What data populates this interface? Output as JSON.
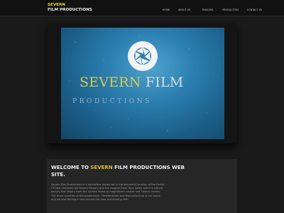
{
  "logo": {
    "line1": "SEVERN",
    "line2": "FILM PRODUCTIONS"
  },
  "nav": {
    "items": [
      {
        "label": "HOME"
      },
      {
        "label": "ABOUT US"
      },
      {
        "label": "TRAILERS"
      },
      {
        "label": "PRODUCTION"
      },
      {
        "label": "CONTACT US"
      }
    ]
  },
  "hero": {
    "brand_word1": "SEVERN",
    "brand_word2": "FILM",
    "brand_sub": "PRODUCTIONS",
    "logo_icon": "camera-aperture-icon"
  },
  "content": {
    "heading_part1": "WELCOME TO ",
    "heading_accent": "SEVERN",
    "heading_part2": " FILM PRODUCTIONS WEB SITE.",
    "body": "Severn Film Productions is a production house set in the wonderful location of the Forest Of Dean between the Severn Estuary and the magical River Wye Valley with it's natural beauty and history from the ancient forest to magnificent castles and historic homes. The three counties of Gloucestershire , Herefordshire and Worcestershire is our home and we love filming in and around the area and sharing with"
  },
  "colors": {
    "accent": "#e2c22a",
    "background": "#1a1a1a",
    "hero_blue": "#2a7eae"
  }
}
